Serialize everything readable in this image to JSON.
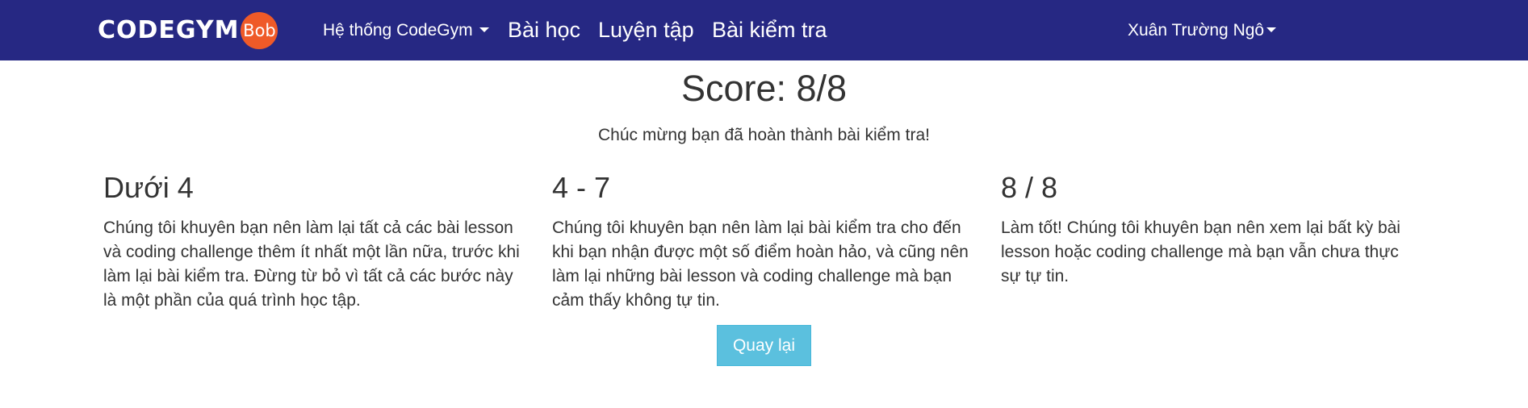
{
  "navbar": {
    "logo_text": "CODEGYM",
    "logo_badge": "Bob",
    "menu_system": "Hệ thống CodeGym",
    "menu_lessons": "Bài học",
    "menu_practice": "Luyện tập",
    "menu_tests": "Bài kiểm tra",
    "user_name": "Xuân Trường Ngô",
    "colors": {
      "background": "#262883",
      "badge": "#ef5a28"
    }
  },
  "result": {
    "score": "Score: 8/8",
    "message": "Chúc mừng bạn đã hoàn thành bài kiểm tra!"
  },
  "ranges": [
    {
      "title": "Dưới 4",
      "text": "Chúng tôi khuyên bạn nên làm lại tất cả các bài lesson và coding challenge thêm ít nhất một lần nữa, trước khi làm lại bài kiểm tra. Đừng từ bỏ vì tất cả các bước này là một phần của quá trình học tập."
    },
    {
      "title": "4 - 7",
      "text": "Chúng tôi khuyên bạn nên làm lại bài kiểm tra cho đến khi bạn nhận được một số điểm hoàn hảo, và cũng nên làm lại những bài lesson và coding challenge mà bạn cảm thấy không tự tin."
    },
    {
      "title": "8 / 8",
      "text": "Làm tốt! Chúng tôi khuyên bạn nên xem lại bất kỳ bài lesson hoặc coding challenge mà bạn vẫn chưa thực sự tự tin."
    }
  ],
  "actions": {
    "back_label": "Quay lại",
    "back_color": "#5bc0de"
  }
}
